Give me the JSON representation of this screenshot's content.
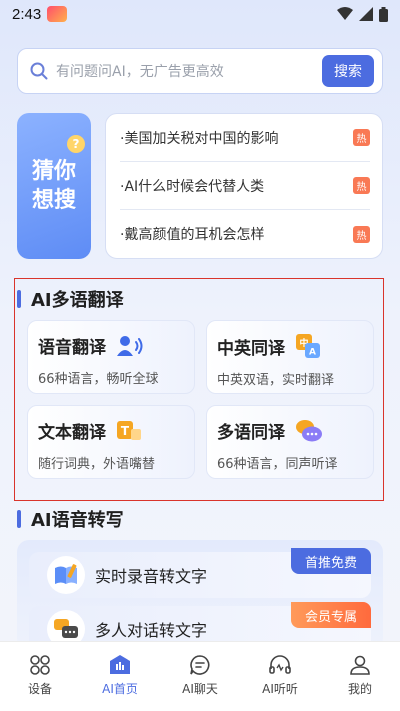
{
  "status_bar": {
    "time": "2:43"
  },
  "search": {
    "placeholder": "有问题问AI，无广告更高效",
    "button_label": "搜索"
  },
  "guess": {
    "line1": "猜你",
    "line2": "想搜",
    "mark": "?"
  },
  "hot_list": [
    {
      "text": "·美国加关税对中国的影响",
      "badge": "热"
    },
    {
      "text": "·AI什么时候会代替人类",
      "badge": "热"
    },
    {
      "text": "·戴高颜值的耳机会怎样",
      "badge": "热"
    }
  ],
  "translate_section": {
    "title": "AI多语翻译",
    "cards": [
      {
        "title": "语音翻译",
        "subtitle": "66种语言，畅听全球",
        "icon": "voice-speaker-icon"
      },
      {
        "title": "中英同译",
        "subtitle": "中英双语，实时翻译",
        "icon": "chinese-english-icon"
      },
      {
        "title": "文本翻译",
        "subtitle": "随行词典，外语嘴替",
        "icon": "text-translate-icon"
      },
      {
        "title": "多语同译",
        "subtitle": "66种语言，同声听译",
        "icon": "chat-bubbles-icon"
      }
    ]
  },
  "transcribe_section": {
    "title": "AI语音转写",
    "items": [
      {
        "label": "实时录音转文字",
        "badge": "首推免费",
        "icon": "book-pen-icon"
      },
      {
        "label": "多人对话转文字",
        "badge": "会员专属",
        "icon": "conversation-icon"
      }
    ]
  },
  "bottom_nav": [
    {
      "label": "设备",
      "icon": "devices-grid-icon",
      "active": false
    },
    {
      "label": "AI首页",
      "icon": "ai-home-icon",
      "active": true
    },
    {
      "label": "AI聊天",
      "icon": "chat-icon",
      "active": false
    },
    {
      "label": "AI听听",
      "icon": "headphones-icon",
      "active": false
    },
    {
      "label": "我的",
      "icon": "profile-icon",
      "active": false
    }
  ],
  "colors": {
    "accent": "#4c6ce0",
    "hot_badge": "#f97955",
    "free_badge": "#4c6ce0",
    "vip_badge": "#ff7a45",
    "highlight_border": "#d9342b"
  }
}
